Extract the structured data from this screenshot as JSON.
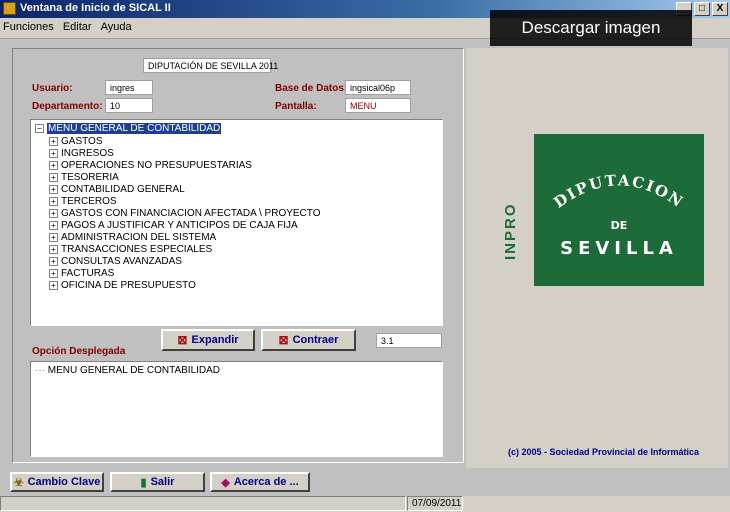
{
  "window": {
    "title": "Ventana de Inicio de SICAL II",
    "controls": [
      "_",
      "□",
      "X"
    ]
  },
  "overlay": {
    "label": "Descargar imagen"
  },
  "menu": [
    "Funciones",
    "Editar",
    "Ayuda"
  ],
  "header": {
    "entity": "DIPUTACIÓN DE SEVILLA 2011",
    "usuario_label": "Usuario:",
    "usuario_value": "ingres",
    "base_label": "Base de Datos:",
    "base_value": "ingsical06p",
    "departamento_label": "Departamento:",
    "departamento_value": "10",
    "pantalla_label": "Pantalla:",
    "pantalla_value": "MENU"
  },
  "tree": {
    "root": "MENU GENERAL DE CONTABILIDAD",
    "items": [
      "GASTOS",
      "INGRESOS",
      "OPERACIONES NO PRESUPUESTARIAS",
      "TESORERIA",
      "CONTABILIDAD GENERAL",
      "TERCEROS",
      "GASTOS CON FINANCIACION AFECTADA \\ PROYECTO",
      "PAGOS A JUSTIFICAR Y ANTICIPOS DE CAJA FIJA",
      "ADMINISTRACION DEL SISTEMA",
      "TRANSACCIONES ESPECIALES",
      "CONSULTAS AVANZADAS",
      "FACTURAS",
      "OFICINA DE PRESUPUESTO"
    ]
  },
  "actions": {
    "expand": "Expandir",
    "collapse": "Contraer",
    "code": "3.1"
  },
  "opcion": {
    "label": "Opción Desplegada",
    "value": "MENU GENERAL DE CONTABILIDAD"
  },
  "logo": {
    "line1": "DIPUTACION",
    "line2": "DE",
    "line3": "SEVILLA",
    "brand": "INPRO"
  },
  "copyright": "(c) 2005 - Sociedad Provincial de Informática",
  "bottom": {
    "cambio": "Cambio Clave",
    "salir": "Salir",
    "acerca": "Acerca de ..."
  },
  "status": {
    "date": "07/09/2011"
  }
}
